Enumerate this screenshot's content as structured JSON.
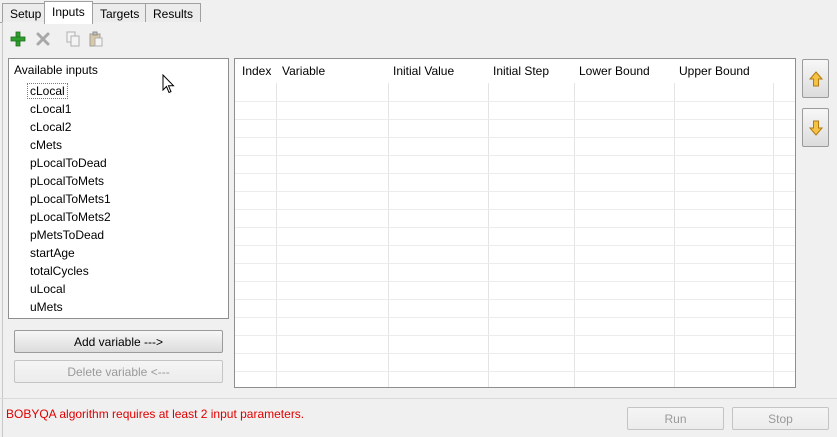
{
  "tabs": [
    {
      "label": "Setup",
      "active": false
    },
    {
      "label": "Inputs",
      "active": true
    },
    {
      "label": "Targets",
      "active": false
    },
    {
      "label": "Results",
      "active": false
    }
  ],
  "toolbar": {
    "icons": [
      "add-icon",
      "delete-icon",
      "copy-icon",
      "paste-icon"
    ],
    "add_color": "#2e9e2e"
  },
  "available_inputs": {
    "title": "Available inputs",
    "items": [
      "cLocal",
      "cLocal1",
      "cLocal2",
      "cMets",
      "pLocalToDead",
      "pLocalToMets",
      "pLocalToMets1",
      "pLocalToMets2",
      "pMetsToDead",
      "startAge",
      "totalCycles",
      "uLocal",
      "uMets"
    ],
    "selected": "cLocal"
  },
  "buttons": {
    "add_variable": "Add variable --->",
    "delete_variable": "Delete variable <---",
    "run": "Run",
    "stop": "Stop"
  },
  "table": {
    "columns": [
      "Index",
      "Variable",
      "Initial Value",
      "Initial Step",
      "Lower Bound",
      "Upper Bound"
    ],
    "rows": []
  },
  "status": {
    "message": "BOBYQA algorithm requires at least 2 input parameters.",
    "color": "#e00000"
  },
  "move_buttons": {
    "up_icon": "arrow-up-icon",
    "down_icon": "arrow-down-icon",
    "arrow_color": "#e8a62c"
  }
}
